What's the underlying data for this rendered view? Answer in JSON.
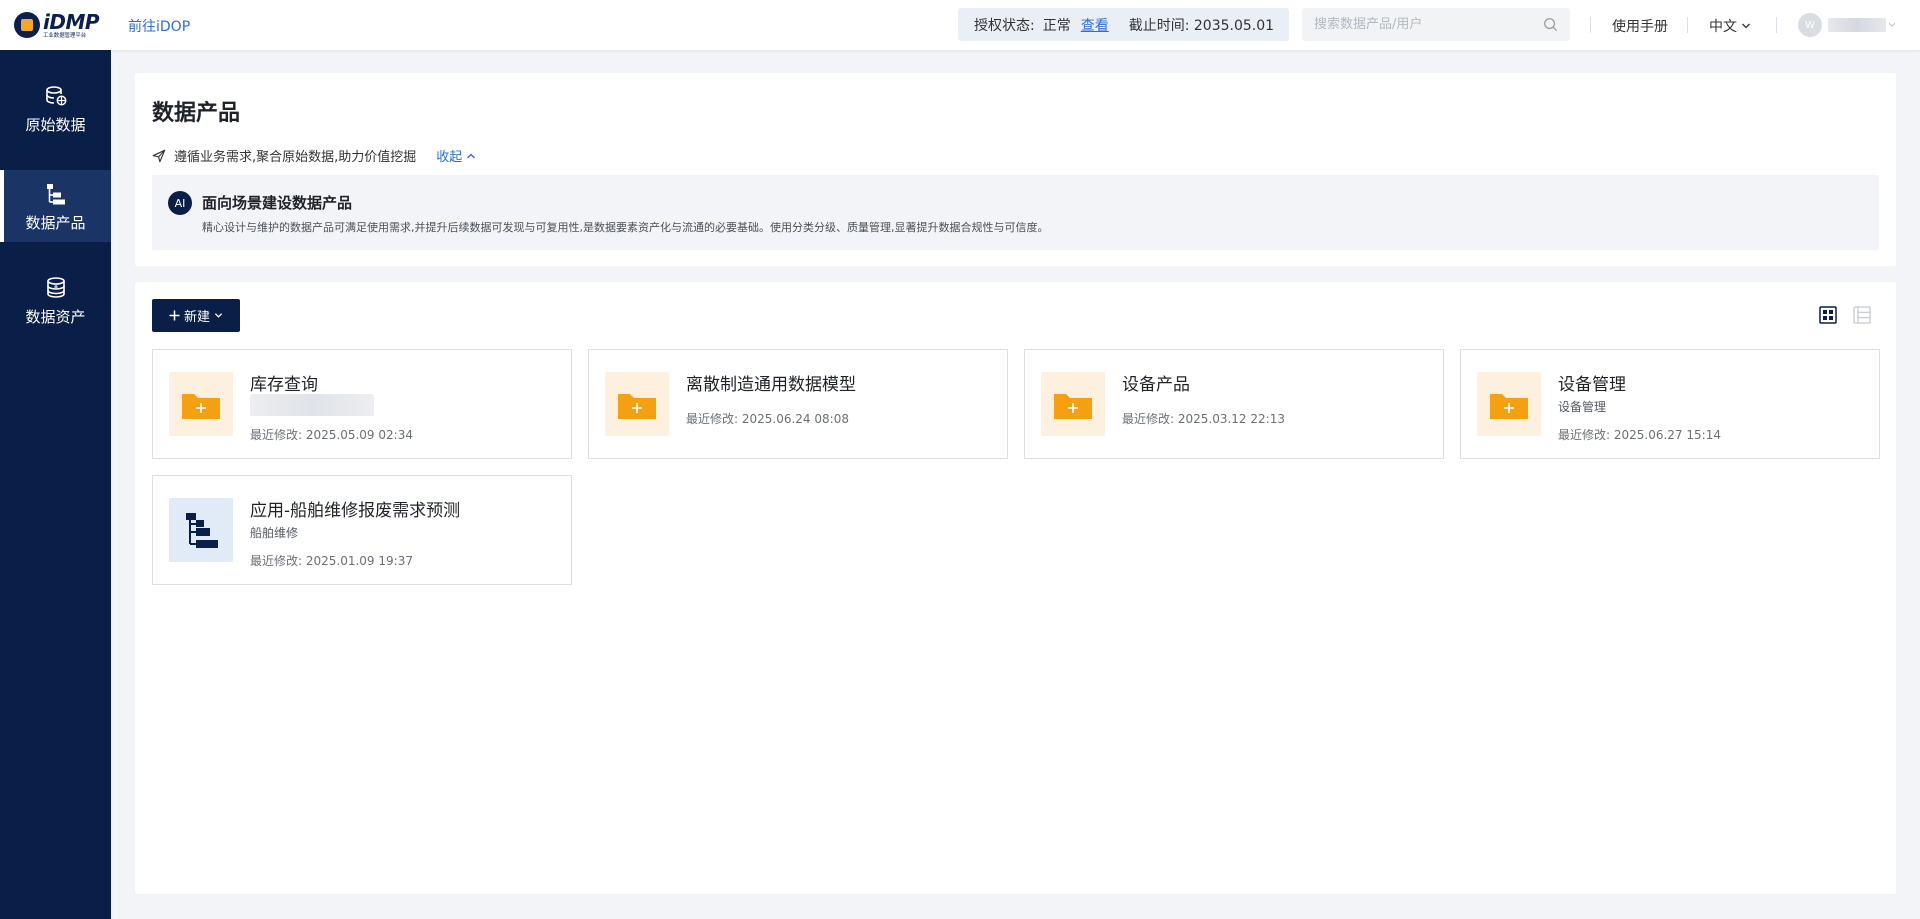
{
  "topbar": {
    "logo_word": "iDMP",
    "logo_sub": "工业数据管理平台",
    "goto_link": "前往iDOP",
    "license_status_label": "授权状态:",
    "license_status_value": "正常",
    "license_view_link": "查看",
    "license_deadline": "截止时间: 2035.05.01",
    "search_placeholder": "搜索数据产品/用户",
    "manual": "使用手册",
    "language": "中文",
    "avatar_letter": "W"
  },
  "sidebar": {
    "items": [
      {
        "label": "原始数据",
        "icon": "database-icon",
        "active": false
      },
      {
        "label": "数据产品",
        "icon": "tree-structure-icon",
        "active": true
      },
      {
        "label": "数据资产",
        "icon": "coins-icon",
        "active": false
      }
    ]
  },
  "header": {
    "title": "数据产品",
    "tagline": "遵循业务需求,聚合原始数据,助力价值挖掘",
    "collapse_label": "收起",
    "ai_badge": "AI",
    "ai_title": "面向场景建设数据产品",
    "ai_desc": "精心设计与维护的数据产品可满足使用需求,并提升后续数据可发现与可复用性,是数据要素资产化与流通的必要基础。使用分类分级、质量管理,显著提升数据合规性与可信度。"
  },
  "main": {
    "new_button": "新建",
    "tiles": [
      {
        "title": "库存查询",
        "subtitle": "",
        "modified": "最近修改: 2025.05.09 02:34",
        "type": "folder",
        "blurred_subtitle": true
      },
      {
        "title": "离散制造通用数据模型",
        "subtitle": "",
        "modified": "最近修改: 2025.06.24 08:08",
        "type": "folder",
        "blurred_subtitle": false
      },
      {
        "title": "设备产品",
        "subtitle": "",
        "modified": "最近修改: 2025.03.12 22:13",
        "type": "folder",
        "blurred_subtitle": false
      },
      {
        "title": "设备管理",
        "subtitle": "设备管理",
        "modified": "最近修改: 2025.06.27 15:14",
        "type": "folder",
        "blurred_subtitle": false
      },
      {
        "title": "应用-船舶维修报废需求预测",
        "subtitle": "船舶维修",
        "modified": "最近修改: 2025.01.09 19:37",
        "type": "model",
        "blurred_subtitle": false
      }
    ]
  },
  "colors": {
    "navy": "#0a1f48",
    "link_blue": "#2d6cdf",
    "folder_orange": "#f5a010",
    "folder_bg": "#fdf0de"
  }
}
